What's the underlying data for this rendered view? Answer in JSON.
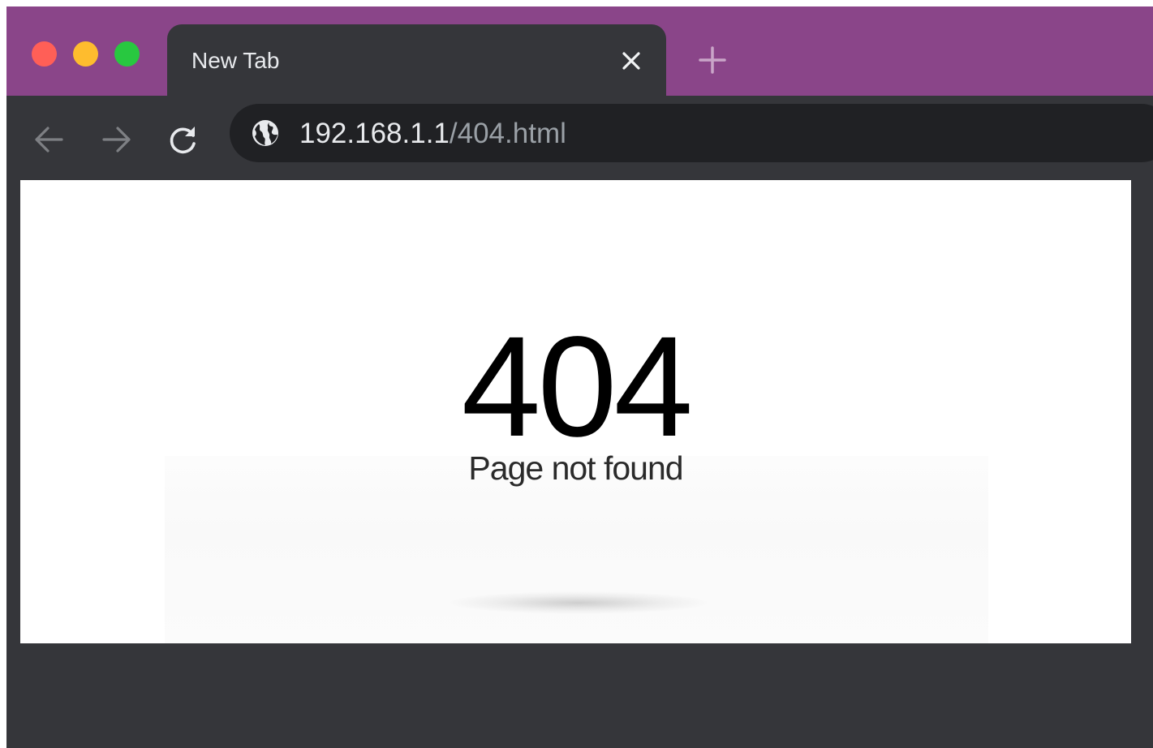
{
  "window": {
    "controls": {
      "close_color": "#ff5f57",
      "minimize_color": "#febc2e",
      "zoom_color": "#28c840"
    },
    "tabstrip_color": "#8a4589"
  },
  "tab": {
    "title": "New Tab",
    "close_icon": "close-icon",
    "new_tab_icon": "plus-icon"
  },
  "toolbar": {
    "back_icon": "arrow-left-icon",
    "forward_icon": "arrow-right-icon",
    "reload_icon": "reload-icon",
    "site_info_icon": "globe-icon"
  },
  "address_bar": {
    "host": "192.168.1.1",
    "path": "/404.html"
  },
  "page": {
    "error_code": "404",
    "error_message": "Page not found"
  }
}
